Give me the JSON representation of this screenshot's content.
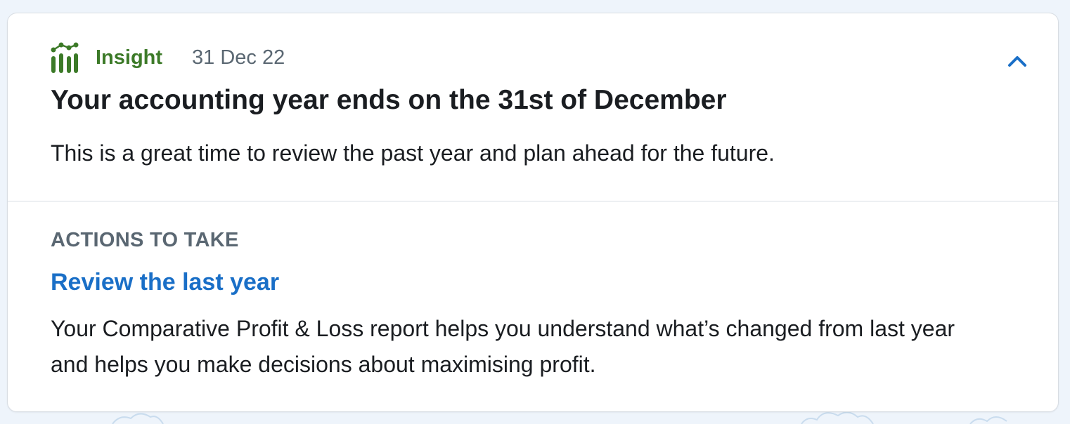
{
  "insight": {
    "label": "Insight",
    "date": "31 Dec 22",
    "icon": "insight-bars-icon",
    "collapse_icon": "chevron-up-icon",
    "title": "Your accounting year ends on the 31st of December",
    "description": "This is a great time to review the past year and plan ahead for the future."
  },
  "actions": {
    "heading": "ACTIONS TO TAKE",
    "items": [
      {
        "link_label": "Review the last year",
        "description": "Your Comparative Profit & Loss report helps you understand what’s changed from last year and helps you make decisions about maximising profit."
      }
    ]
  },
  "colors": {
    "insight_green": "#3c7a28",
    "link_blue": "#1a6fc7",
    "muted_text": "#5a6772",
    "body_text": "#1a1d21",
    "page_background": "#eef4fb"
  }
}
